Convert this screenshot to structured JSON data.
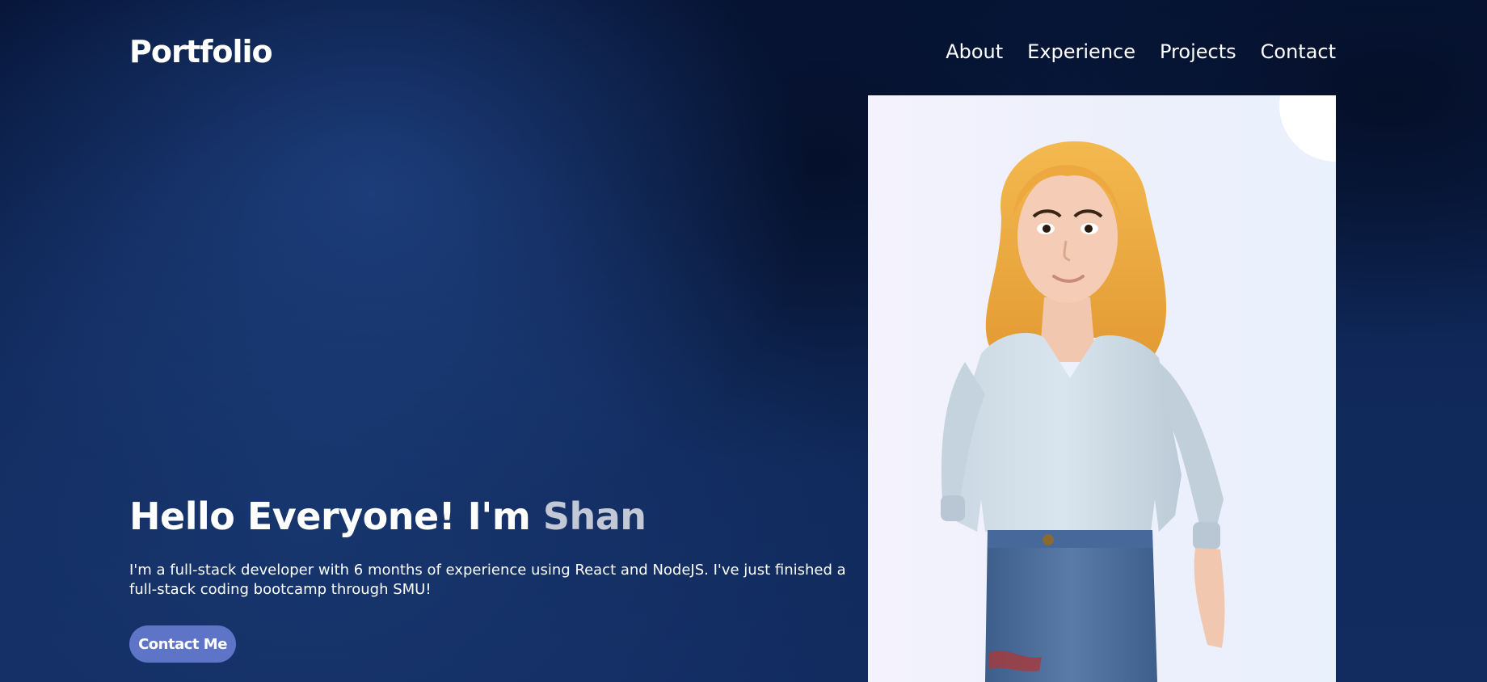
{
  "navbar": {
    "brand": "Portfolio",
    "links": [
      "About",
      "Experience",
      "Projects",
      "Contact"
    ]
  },
  "hero": {
    "title_prefix": "Hello Everyone! I'm ",
    "title_name": "Shan",
    "description": "I'm a full-stack developer with 6 months of experience using React and NodeJS. I've just finished a full-stack coding bootcamp through SMU!",
    "cta_label": "Contact Me"
  },
  "colors": {
    "background": "#0b1c3f",
    "accent_button": "#5e74c6",
    "name_highlight": "#c3c8d6",
    "image_panel": "#eef0fb"
  },
  "icons": {
    "hero_image": "3d-avatar-woman-portrait"
  }
}
